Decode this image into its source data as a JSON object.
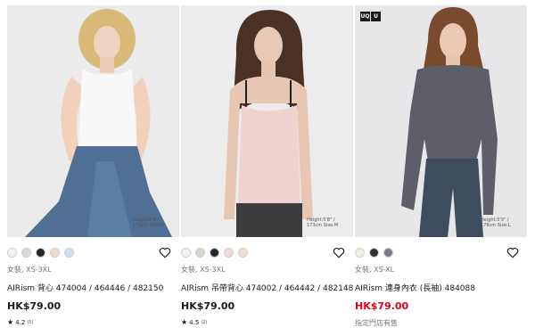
{
  "products": [
    {
      "height_note": "Height:5'8\" / 172cm Size:M",
      "swatch_colors": [
        "#f2f2f2",
        "#d9d9d9",
        "#262626",
        "#eadcd0",
        "#cfdcf2"
      ],
      "category": "女裝, XS-3XL",
      "name": "AIRism 背心 474004 / 464446 / 482150",
      "price": "HK$79.00",
      "rating": "4.2",
      "review_count": "(5)",
      "icon": "heart-icon"
    },
    {
      "height_note": "Height:5'8\" / 173cm Size:M",
      "swatch_colors": [
        "#f2f2f2",
        "#d9d4c8",
        "#262626",
        "#f3d9dc",
        "#eedfd1"
      ],
      "category": "女裝, XS-3XL",
      "name": "AIRism 吊帶背心 474002 / 464442 / 482148",
      "price": "HK$79.00",
      "rating": "4.5",
      "review_count": "(2)",
      "icon": "heart-icon"
    },
    {
      "logo_left": "UQ",
      "logo_right": "U",
      "height_note": "Height:5'9\" / 176cm Size:L",
      "swatch_colors": [
        "#efede4",
        "#2d3135",
        "#7a7a86"
      ],
      "category": "女裝, XS-XL",
      "name": "AIRism 連身內衣 (長袖) 484088",
      "price": "HK$79.00",
      "store_note": "指定門店有售",
      "sale_color": "#e60012",
      "icon": "heart-icon"
    }
  ]
}
